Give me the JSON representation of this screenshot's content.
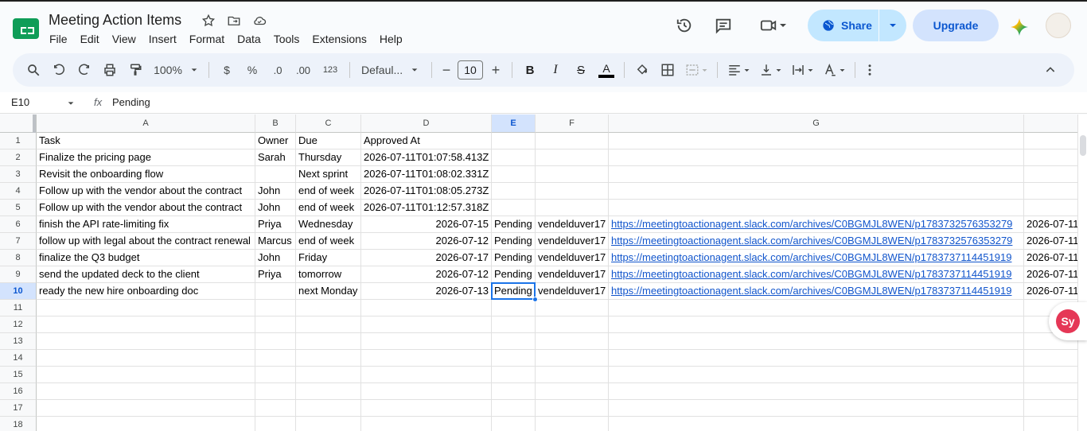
{
  "doc": {
    "title": "Meeting Action Items"
  },
  "menu": [
    "File",
    "Edit",
    "View",
    "Insert",
    "Format",
    "Data",
    "Tools",
    "Extensions",
    "Help"
  ],
  "header": {
    "share_label": "Share",
    "upgrade_label": "Upgrade"
  },
  "toolbar": {
    "zoom": "100%",
    "currency": "$",
    "percent": "%",
    "dec_less": ".0",
    "dec_more": ".00",
    "num_format": "123",
    "font": "Defaul...",
    "font_size": "10"
  },
  "formula_bar": {
    "cell_ref": "E10",
    "fx": "fx",
    "value": "Pending"
  },
  "grid": {
    "columns": [
      "A",
      "B",
      "C",
      "D",
      "E",
      "F",
      "G"
    ],
    "row_numbers": [
      "1",
      "2",
      "3",
      "4",
      "5",
      "6",
      "7",
      "8",
      "9",
      "10",
      "11",
      "12",
      "13",
      "14",
      "15",
      "16",
      "17",
      "18"
    ],
    "rows": [
      [
        "Task",
        "Owner",
        "Due",
        "Approved At",
        "",
        "",
        "",
        ""
      ],
      [
        "Finalize the pricing page",
        "Sarah",
        "Thursday",
        "2026-07-11T01:07:58.413Z",
        "",
        "",
        "",
        ""
      ],
      [
        "Revisit the onboarding flow",
        "",
        "Next sprint",
        "2026-07-11T01:08:02.331Z",
        "",
        "",
        "",
        ""
      ],
      [
        "Follow up with the vendor about the contract",
        "John",
        "end of week",
        "2026-07-11T01:08:05.273Z",
        "",
        "",
        "",
        ""
      ],
      [
        "Follow up with the vendor about the contract",
        "John",
        "end of week",
        "2026-07-11T01:12:57.318Z",
        "",
        "",
        "",
        ""
      ],
      [
        "finish the API rate-limiting fix",
        "Priya",
        "Wednesday",
        "2026-07-15",
        "Pending",
        "vendelduver17",
        "https://meetingtoactionagent.slack.com/archives/C0BGMJL8WEN/p1783732576353279",
        "2026-07-11"
      ],
      [
        "follow up with legal about the contract renewal",
        "Marcus",
        "end of week",
        "2026-07-12",
        "Pending",
        "vendelduver17",
        "https://meetingtoactionagent.slack.com/archives/C0BGMJL8WEN/p1783732576353279",
        "2026-07-11"
      ],
      [
        "finalize the Q3 budget",
        "John",
        "Friday",
        "2026-07-17",
        "Pending",
        "vendelduver17",
        "https://meetingtoactionagent.slack.com/archives/C0BGMJL8WEN/p1783737114451919",
        "2026-07-11"
      ],
      [
        "send the updated deck to the client",
        "Priya",
        "tomorrow",
        "2026-07-12",
        "Pending",
        "vendelduver17",
        "https://meetingtoactionagent.slack.com/archives/C0BGMJL8WEN/p1783737114451919",
        "2026-07-11"
      ],
      [
        "ready the new hire onboarding doc",
        "",
        "next Monday",
        "2026-07-13",
        "Pending",
        "vendelduver17",
        "https://meetingtoactionagent.slack.com/archives/C0BGMJL8WEN/p1783737114451919",
        "2026-07-11"
      ]
    ],
    "selected_cell": "E10"
  },
  "addon_badge": "Sy",
  "colors": {
    "accent": "#0b57d0",
    "selection": "#1a73e8",
    "link": "#1155cc",
    "sheets_green": "#0f9d58"
  }
}
